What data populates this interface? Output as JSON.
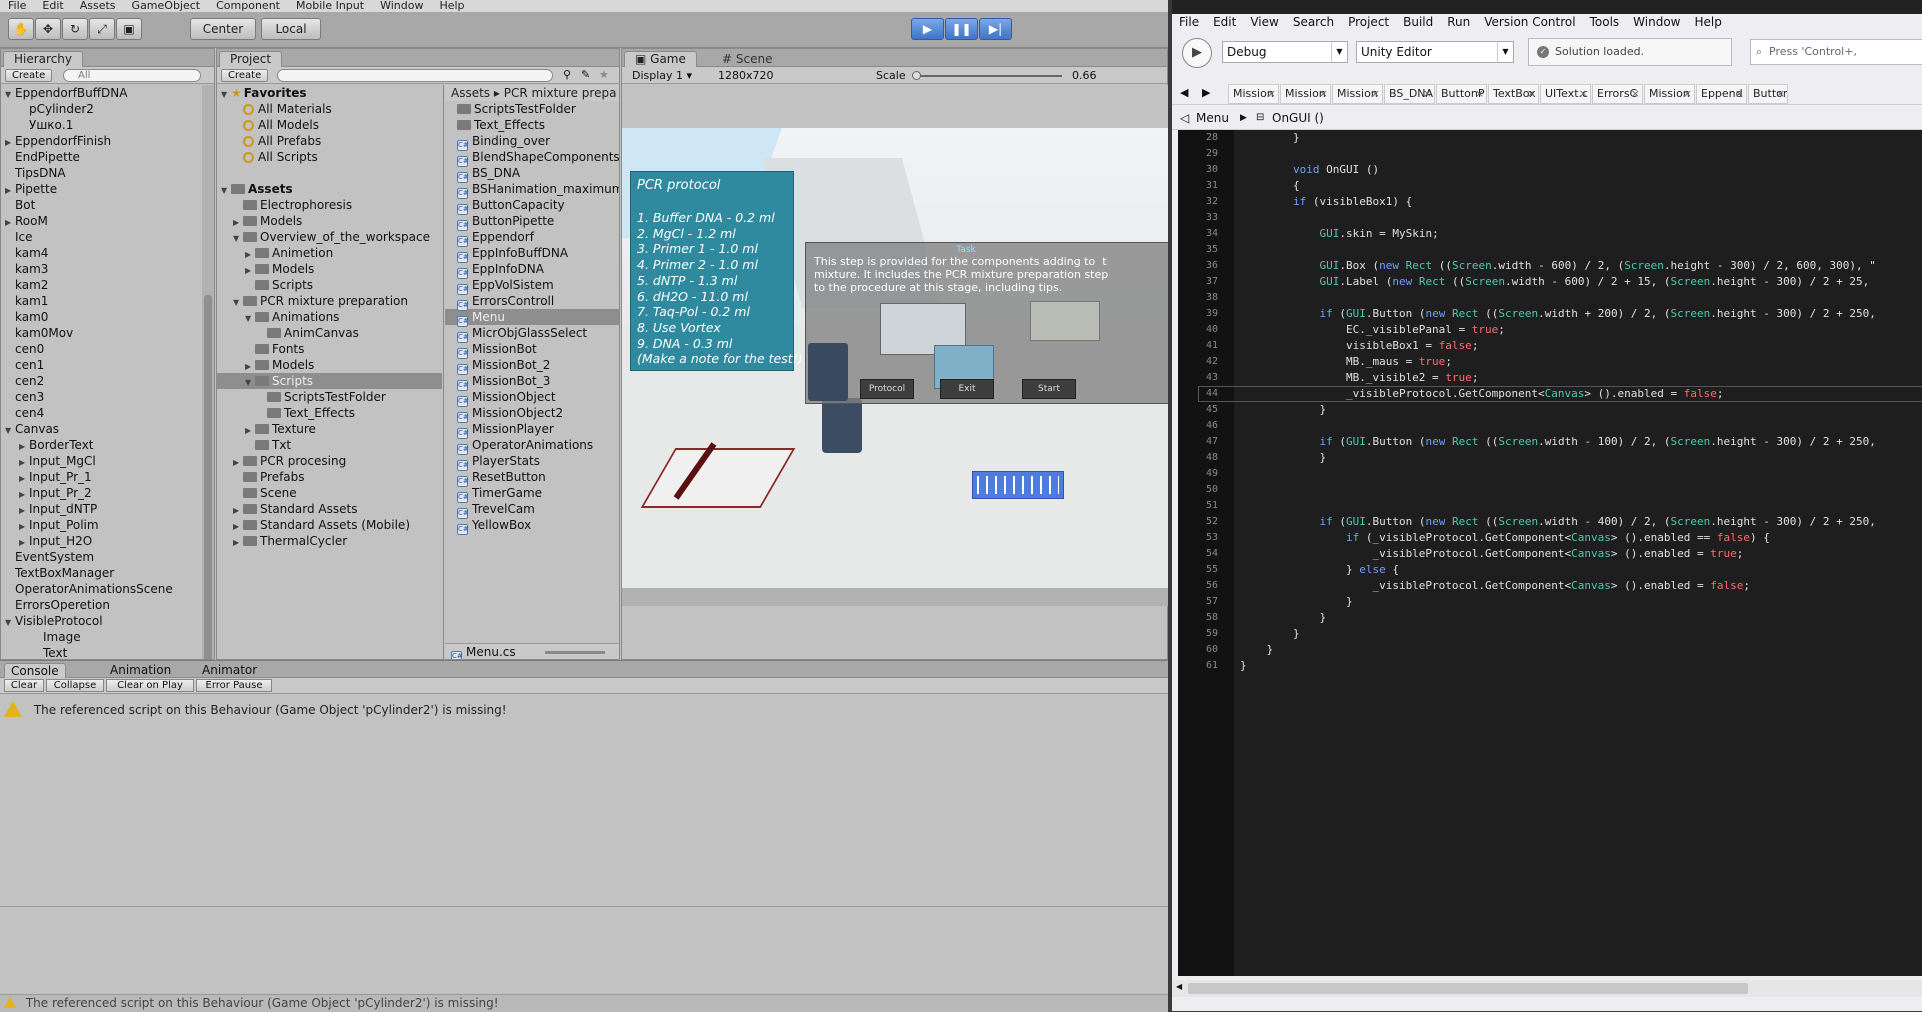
{
  "unity": {
    "menu": [
      "File",
      "Edit",
      "Assets",
      "GameObject",
      "Component",
      "Mobile Input",
      "Window",
      "Help"
    ],
    "toolbar": {
      "center_label": "Center",
      "local_label": "Local"
    },
    "hierarchy": {
      "tab": "Hierarchy",
      "create": "Create",
      "search_placeholder": "All",
      "items": [
        {
          "label": "EppendorfBuffDNA",
          "indent": 0,
          "arrow": "down"
        },
        {
          "label": "pCylinder2",
          "indent": 1,
          "arrow": ""
        },
        {
          "label": "Ушко.1",
          "indent": 1,
          "arrow": ""
        },
        {
          "label": "EppendorfFinish",
          "indent": 0,
          "arrow": "right"
        },
        {
          "label": "EndPipette",
          "indent": 0,
          "arrow": ""
        },
        {
          "label": "TipsDNA",
          "indent": 0,
          "arrow": ""
        },
        {
          "label": "Pipette",
          "indent": 0,
          "arrow": "right"
        },
        {
          "label": "Bot",
          "indent": 0,
          "arrow": ""
        },
        {
          "label": "RooM",
          "indent": 0,
          "arrow": "right"
        },
        {
          "label": "Ice",
          "indent": 0,
          "arrow": ""
        },
        {
          "label": "kam4",
          "indent": 0,
          "arrow": ""
        },
        {
          "label": "kam3",
          "indent": 0,
          "arrow": ""
        },
        {
          "label": "kam2",
          "indent": 0,
          "arrow": ""
        },
        {
          "label": "kam1",
          "indent": 0,
          "arrow": ""
        },
        {
          "label": "kam0",
          "indent": 0,
          "arrow": ""
        },
        {
          "label": "kam0Mov",
          "indent": 0,
          "arrow": ""
        },
        {
          "label": "cen0",
          "indent": 0,
          "arrow": ""
        },
        {
          "label": "cen1",
          "indent": 0,
          "arrow": ""
        },
        {
          "label": "cen2",
          "indent": 0,
          "arrow": ""
        },
        {
          "label": "cen3",
          "indent": 0,
          "arrow": ""
        },
        {
          "label": "cen4",
          "indent": 0,
          "arrow": ""
        },
        {
          "label": "Canvas",
          "indent": 0,
          "arrow": "down"
        },
        {
          "label": "BorderText",
          "indent": 1,
          "arrow": "right"
        },
        {
          "label": "Input_MgCl",
          "indent": 1,
          "arrow": "right"
        },
        {
          "label": "Input_Pr_1",
          "indent": 1,
          "arrow": "right"
        },
        {
          "label": "Input_Pr_2",
          "indent": 1,
          "arrow": "right"
        },
        {
          "label": "Input_dNTP",
          "indent": 1,
          "arrow": "right"
        },
        {
          "label": "Input_Polim",
          "indent": 1,
          "arrow": "right"
        },
        {
          "label": "Input_H2O",
          "indent": 1,
          "arrow": "right"
        },
        {
          "label": "EventSystem",
          "indent": 0,
          "arrow": ""
        },
        {
          "label": "TextBoxManager",
          "indent": 0,
          "arrow": ""
        },
        {
          "label": "OperatorAnimationsScene",
          "indent": 0,
          "arrow": ""
        },
        {
          "label": "ErrorsOperetion",
          "indent": 0,
          "arrow": ""
        },
        {
          "label": "VisibleProtocol",
          "indent": 0,
          "arrow": "down"
        },
        {
          "label": "Image",
          "indent": 2,
          "arrow": ""
        },
        {
          "label": "Text",
          "indent": 2,
          "arrow": ""
        }
      ]
    },
    "project": {
      "tab": "Project",
      "create": "Create",
      "tree": [
        {
          "label": "Favorites",
          "indent": 0,
          "arrow": "down",
          "type": "star"
        },
        {
          "label": "All Materials",
          "indent": 1,
          "arrow": "",
          "type": "search"
        },
        {
          "label": "All Models",
          "indent": 1,
          "arrow": "",
          "type": "search"
        },
        {
          "label": "All Prefabs",
          "indent": 1,
          "arrow": "",
          "type": "search"
        },
        {
          "label": "All Scripts",
          "indent": 1,
          "arrow": "",
          "type": "search"
        },
        {
          "label": "",
          "indent": 0,
          "arrow": "",
          "type": "blank"
        },
        {
          "label": "Assets",
          "indent": 0,
          "arrow": "down",
          "type": "folder"
        },
        {
          "label": "Electrophoresis",
          "indent": 1,
          "arrow": "",
          "type": "folder"
        },
        {
          "label": "Models",
          "indent": 1,
          "arrow": "right",
          "type": "folder"
        },
        {
          "label": "Overview_of_the_workspace",
          "indent": 1,
          "arrow": "down",
          "type": "folder"
        },
        {
          "label": "Animetion",
          "indent": 2,
          "arrow": "right",
          "type": "folder"
        },
        {
          "label": "Models",
          "indent": 2,
          "arrow": "right",
          "type": "folder"
        },
        {
          "label": "Scripts",
          "indent": 2,
          "arrow": "",
          "type": "folder"
        },
        {
          "label": "PCR mixture preparation",
          "indent": 1,
          "arrow": "down",
          "type": "folder"
        },
        {
          "label": "Animations",
          "indent": 2,
          "arrow": "down",
          "type": "folder"
        },
        {
          "label": "AnimCanvas",
          "indent": 3,
          "arrow": "",
          "type": "folder"
        },
        {
          "label": "Fonts",
          "indent": 2,
          "arrow": "",
          "type": "folder"
        },
        {
          "label": "Models",
          "indent": 2,
          "arrow": "right",
          "type": "folder"
        },
        {
          "label": "Scripts",
          "indent": 2,
          "arrow": "down",
          "type": "folder",
          "selected": true
        },
        {
          "label": "ScriptsTestFolder",
          "indent": 3,
          "arrow": "",
          "type": "folder"
        },
        {
          "label": "Text_Effects",
          "indent": 3,
          "arrow": "",
          "type": "folder"
        },
        {
          "label": "Texture",
          "indent": 2,
          "arrow": "right",
          "type": "folder"
        },
        {
          "label": "Txt",
          "indent": 2,
          "arrow": "",
          "type": "folder"
        },
        {
          "label": "PCR procesing",
          "indent": 1,
          "arrow": "right",
          "type": "folder"
        },
        {
          "label": "Prefabs",
          "indent": 1,
          "arrow": "",
          "type": "folder"
        },
        {
          "label": "Scene",
          "indent": 1,
          "arrow": "",
          "type": "folder"
        },
        {
          "label": "Standard Assets",
          "indent": 1,
          "arrow": "right",
          "type": "folder"
        },
        {
          "label": "Standard Assets (Mobile)",
          "indent": 1,
          "arrow": "right",
          "type": "folder"
        },
        {
          "label": "ThermalCycler",
          "indent": 1,
          "arrow": "right",
          "type": "folder"
        }
      ],
      "breadcrumb": "Assets ▸ PCR mixture prepa",
      "files": [
        {
          "label": "ScriptsTestFolder",
          "type": "folder"
        },
        {
          "label": "Text_Effects",
          "type": "folder"
        },
        {
          "label": "Binding_over",
          "type": "script"
        },
        {
          "label": "BlendShapeComponents",
          "type": "script"
        },
        {
          "label": "BS_DNA",
          "type": "script"
        },
        {
          "label": "BSHanimation_maximum",
          "type": "script"
        },
        {
          "label": "ButtonCapacity",
          "type": "script"
        },
        {
          "label": "ButtonPipette",
          "type": "script"
        },
        {
          "label": "Eppendorf",
          "type": "script"
        },
        {
          "label": "EppInfoBuffDNA",
          "type": "script"
        },
        {
          "label": "EppInfoDNA",
          "type": "script"
        },
        {
          "label": "EppVolSistem",
          "type": "script"
        },
        {
          "label": "ErrorsControll",
          "type": "script"
        },
        {
          "label": "Menu",
          "type": "script",
          "selected": true
        },
        {
          "label": "MicrObjGlassSelect",
          "type": "script"
        },
        {
          "label": "MissionBot",
          "type": "script"
        },
        {
          "label": "MissionBot_2",
          "type": "script"
        },
        {
          "label": "MissionBot_3",
          "type": "script"
        },
        {
          "label": "MissionObject",
          "type": "script"
        },
        {
          "label": "MissionObject2",
          "type": "script"
        },
        {
          "label": "MissionPlayer",
          "type": "script"
        },
        {
          "label": "OperatorAnimations",
          "type": "script"
        },
        {
          "label": "PlayerStats",
          "type": "script"
        },
        {
          "label": "ResetButton",
          "type": "script"
        },
        {
          "label": "TimerGame",
          "type": "script"
        },
        {
          "label": "TrevelCam",
          "type": "script"
        },
        {
          "label": "YellowBox",
          "type": "script"
        }
      ],
      "footer": "Menu.cs"
    },
    "game": {
      "tab_game": "Game",
      "tab_scene": "Scene",
      "display": "Display 1",
      "resolution": "1280x720",
      "scale_label": "Scale",
      "scale_value": "0.66",
      "protocol": {
        "title": "PCR protocol",
        "lines": [
          "1. Buffer DNA - 0.2 ml",
          "2. MgCl - 1.2 ml",
          "3. Primer 1 - 1.0 ml",
          "4. Primer 2 - 1.0 ml",
          "5. dNTP - 1.3 ml",
          "6. dH2O - 11.0 ml",
          "7. Taq-Pol - 0.2 ml",
          "8. Use Vortex",
          "9. DNA - 0.3 ml",
          "(Make a note for the test!)"
        ]
      },
      "task": {
        "title": "Task",
        "text": "This step is provided for the components adding to  t\nmixture. It includes the PCR mixture preparation step\nto the procedure at this stage, including tips.",
        "buttons": [
          "Protocol",
          "Exit",
          "Start"
        ]
      }
    },
    "console": {
      "tabs": [
        "Console",
        "Animation",
        "Animator"
      ],
      "buttons": [
        "Clear",
        "Collapse",
        "Clear on Play",
        "Error Pause"
      ],
      "message": "The referenced script on this Behaviour (Game Object 'pCylinder2') is missing!",
      "status": "The referenced script on this Behaviour (Game Object 'pCylinder2') is missing!"
    }
  },
  "vs": {
    "menu": [
      "File",
      "Edit",
      "View",
      "Search",
      "Project",
      "Build",
      "Run",
      "Version Control",
      "Tools",
      "Window",
      "Help"
    ],
    "config": "Debug",
    "target": "Unity Editor",
    "status": "Solution loaded.",
    "search_placeholder": "Press 'Control+,",
    "tabs": [
      "Mission",
      "Mission",
      "Mission",
      "BS_DNA",
      "ButtonP",
      "TextBox",
      "UIText.c",
      "ErrorsC",
      "Mission",
      "Eppend",
      "Button"
    ],
    "nav": {
      "class": "Menu",
      "method": "OnGUI ()"
    },
    "line_start": 28,
    "code": [
      "        }",
      "",
      "        <k>void</k> OnGUI ()",
      "        {",
      "        <k>if</k> (visibleBox1) {",
      "",
      "            <t>GUI</t>.skin = MySkin;",
      "",
      "            <t>GUI</t>.Box (<k>new</k> <t>Rect</t> ((<t>Screen</t>.width - 600) / 2, (<t>Screen</t>.height - 300) / 2, 600, 300), \"",
      "            <t>GUI</t>.Label (<k>new</k> <t>Rect</t> ((<t>Screen</t>.width - 600) / 2 + 15, (<t>Screen</t>.height - 300) / 2 + 25,",
      "",
      "            <k>if</k> (<t>GUI</t>.Button (<k>new</k> <t>Rect</t> ((<t>Screen</t>.width + 200) / 2, (<t>Screen</t>.height - 300) / 2 + 250,",
      "                EC._visiblePanal = <f>true</f>;",
      "                visibleBox1 = <f>false</f>;",
      "                MB._maus = <f>true</f>;",
      "                MB._visible2 = <f>true</f>;",
      "                _visibleProtocol.GetComponent&lt;<t>Canvas</t>&gt; ().enabled = <f>false</f>;",
      "            }",
      "",
      "            <k>if</k> (<t>GUI</t>.Button (<k>new</k> <t>Rect</t> ((<t>Screen</t>.width - 100) / 2, (<t>Screen</t>.height - 300) / 2 + 250,",
      "            }",
      "",
      "",
      "",
      "            <k>if</k> (<t>GUI</t>.Button (<k>new</k> <t>Rect</t> ((<t>Screen</t>.width - 400) / 2, (<t>Screen</t>.height - 300) / 2 + 250,",
      "                <k>if</k> (_visibleProtocol.GetComponent&lt;<t>Canvas</t>&gt; ().enabled == <f>false</f>) {",
      "                    _visibleProtocol.GetComponent&lt;<t>Canvas</t>&gt; ().enabled = <f>true</f>;",
      "                } <k>else</k> {",
      "                    _visibleProtocol.GetComponent&lt;<t>Canvas</t>&gt; ().enabled = <f>false</f>;",
      "                }",
      "            }",
      "        }",
      "    }",
      "}"
    ]
  }
}
